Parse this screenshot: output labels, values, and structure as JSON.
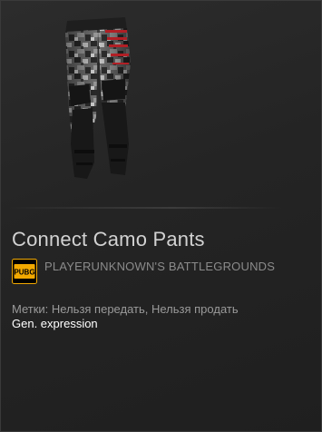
{
  "item": {
    "name": "Connect Camo Pants",
    "image_icon": "camo-pants-icon"
  },
  "game": {
    "icon": "pubg-logo-icon",
    "icon_text": "PUBG",
    "name": "PLAYERUNKNOWN'S BATTLEGROUNDS"
  },
  "tags_text": "Метки: Нельзя передать, Нельзя продать",
  "gen_text": "Gen. expression",
  "colors": {
    "background": "#242424",
    "name": "#d2d2d2",
    "game_name": "#8b8b8b",
    "tags": "#9a9a9a",
    "gen": "#ffffff",
    "pubg_badge": "#f2a900",
    "stripe_red": "#b11f25"
  }
}
